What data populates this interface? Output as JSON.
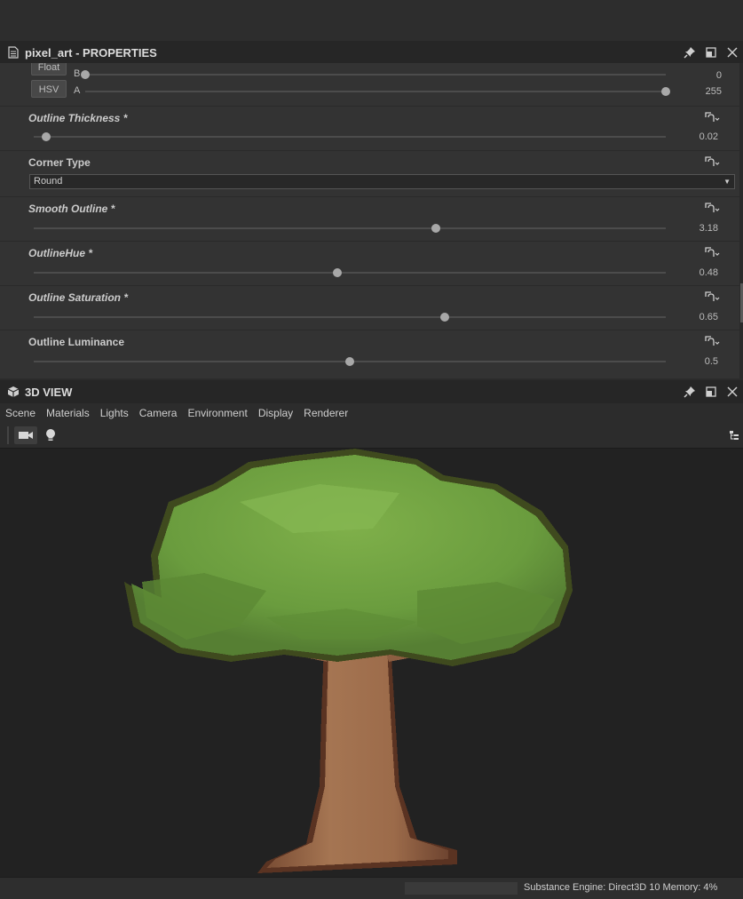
{
  "properties_panel": {
    "title": "pixel_art - PROPERTIES",
    "buttons": {
      "float": "Float",
      "hsv": "HSV"
    },
    "channels": [
      {
        "label": "B",
        "value": "0",
        "fraction": 0.0
      },
      {
        "label": "A",
        "value": "255",
        "fraction": 1.0
      }
    ],
    "props": [
      {
        "name": "Outline Thickness *",
        "value": "0.02",
        "fraction": 0.02
      },
      {
        "name": "Corner Type",
        "selected": "Round"
      },
      {
        "name": "Smooth Outline *",
        "value": "3.18",
        "fraction": 0.636
      },
      {
        "name": "OutlineHue *",
        "value": "0.48",
        "fraction": 0.48
      },
      {
        "name": "Outline Saturation *",
        "value": "0.65",
        "fraction": 0.65
      },
      {
        "name": "Outline Luminance",
        "value": "0.5",
        "fraction": 0.5
      }
    ]
  },
  "view3d": {
    "title": "3D VIEW",
    "menu": [
      "Scene",
      "Materials",
      "Lights",
      "Camera",
      "Environment",
      "Display",
      "Renderer"
    ],
    "toolbar_icons": [
      "camera-icon",
      "light-bulb-icon",
      "hierarchy-icon"
    ]
  },
  "status": {
    "text": "Substance Engine: Direct3D 10   Memory: 4%"
  },
  "colors": {
    "panel_bg": "#333333",
    "header_bg": "#262626",
    "viewport_bg": "#222222",
    "foliage": "#6fa040",
    "trunk": "#9a6a48"
  }
}
